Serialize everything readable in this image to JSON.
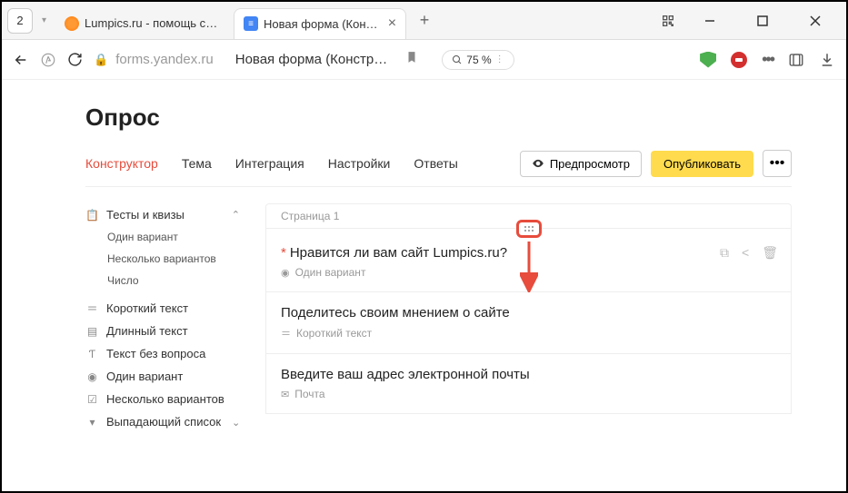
{
  "browser": {
    "tab_count": "2",
    "tabs": [
      {
        "title": "Lumpics.ru - помощь с ком",
        "active": false
      },
      {
        "title": "Новая форма (Констру",
        "active": true
      }
    ],
    "url": "forms.yandex.ru",
    "page_title": "Новая форма (Констр…",
    "zoom": "75 %"
  },
  "page": {
    "heading": "Опрос",
    "nav": {
      "constructor": "Конструктор",
      "theme": "Тема",
      "integration": "Интеграция",
      "settings": "Настройки",
      "answers": "Ответы"
    },
    "buttons": {
      "preview": "Предпросмотр",
      "publish": "Опубликовать"
    }
  },
  "sidebar": {
    "tests_quizzes": "Тесты и квизы",
    "sub": {
      "one_variant": "Один вариант",
      "multi_variant": "Несколько вариантов",
      "number": "Число"
    },
    "short_text": "Короткий текст",
    "long_text": "Длинный текст",
    "no_question": "Текст без вопроса",
    "one_variant": "Один вариант",
    "multi_variant": "Несколько вариантов",
    "dropdown": "Выпадающий список"
  },
  "canvas": {
    "page_label": "Страница 1",
    "questions": [
      {
        "required": true,
        "title": "Нравится ли вам сайт Lumpics.ru?",
        "type_label": "Один вариант"
      },
      {
        "required": false,
        "title": "Поделитесь своим мнением о сайте",
        "type_label": "Короткий текст"
      },
      {
        "required": false,
        "title": "Введите ваш адрес электронной почты",
        "type_label": "Почта"
      }
    ]
  }
}
